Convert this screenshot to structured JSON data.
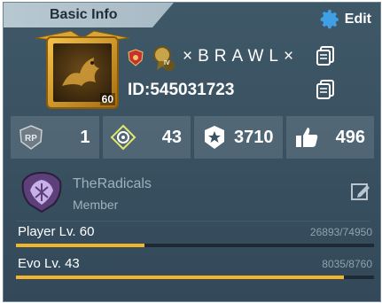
{
  "header": {
    "title": "Basic Info",
    "edit_label": "Edit"
  },
  "profile": {
    "level": "60",
    "name": "×BRAWL×",
    "id_text": "ID:545031723",
    "badge_tier": "IV"
  },
  "stats": [
    {
      "icon": "rp-icon",
      "value": "1"
    },
    {
      "icon": "diamond-target-icon",
      "value": "43"
    },
    {
      "icon": "star-badge-icon",
      "value": "3710"
    },
    {
      "icon": "thumbs-up-icon",
      "value": "496"
    }
  ],
  "clan": {
    "name": "TheRadicals",
    "role": "Member"
  },
  "levels": [
    {
      "label": "Player Lv. 60",
      "progress": "26893/74950",
      "fraction": 0.359
    },
    {
      "label": "Evo Lv. 43",
      "progress": "8035/8760",
      "fraction": 0.917
    }
  ],
  "colors": {
    "accent": "#f5b52a",
    "panel": "#3a5262",
    "header": "#b9c9d2"
  }
}
